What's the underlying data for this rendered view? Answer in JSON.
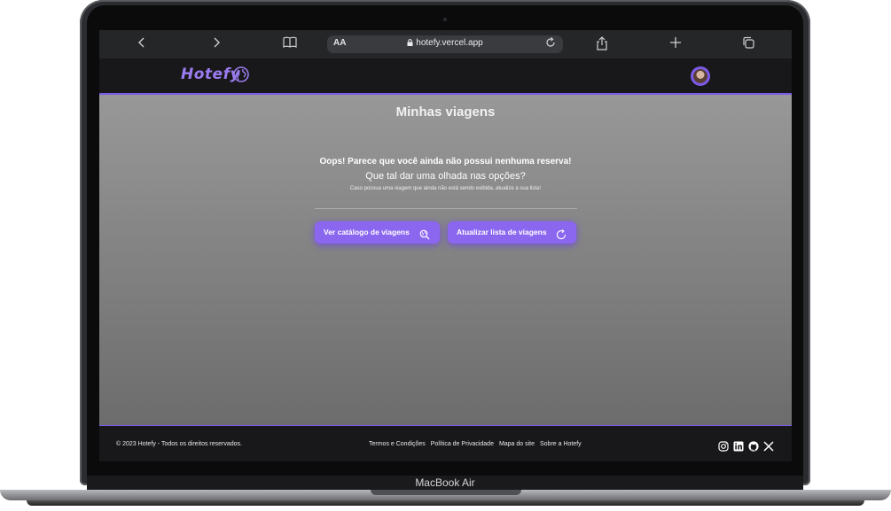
{
  "device": {
    "label": "MacBook Air"
  },
  "browser": {
    "text_size_label": "AA",
    "url": "hotefy.vercel.app",
    "icons": [
      "chevron-left-icon",
      "chevron-right-icon",
      "book-icon",
      "lock-icon",
      "reload-icon",
      "share-icon",
      "plus-icon",
      "tabs-icon"
    ]
  },
  "header": {
    "logo_text": "Hotefy",
    "logo_icon": "globe-icon"
  },
  "main": {
    "title": "Minhas viagens",
    "empty_title": "Oops! Parece que você ainda não possui nenhuma reserva!",
    "empty_subtitle": "Que tal dar uma olhada nas opções?",
    "empty_note": "Caso possua uma viagem que ainda não está sendo exibida, atualize a sua lista!",
    "buttons": {
      "catalog_label": "Ver catálogo de viagens",
      "refresh_label": "Atualizar lista de viagens"
    }
  },
  "footer": {
    "copyright": "© 2023 Hotefy - Todos os direitos reservados.",
    "links": [
      "Termos e Condições",
      "Política de Privacidade",
      "Mapa do site",
      "Sobre a Hotefy"
    ],
    "social": [
      "instagram-icon",
      "linkedin-icon",
      "github-icon",
      "x-icon"
    ]
  },
  "colors": {
    "accent": "#8b67f0",
    "header_bg": "#18181a",
    "main_bg_top": "#989898",
    "main_bg_bottom": "#6c6c6c"
  }
}
